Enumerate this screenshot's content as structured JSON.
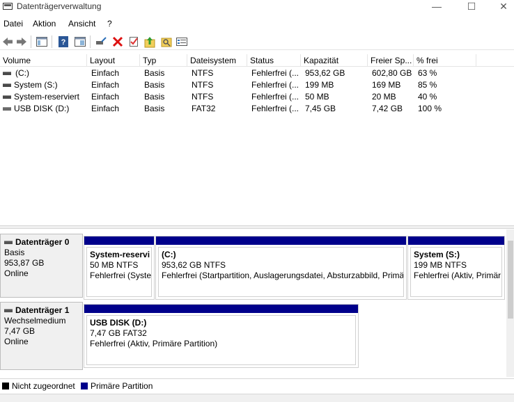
{
  "window": {
    "title": "Datenträgerverwaltung",
    "minimize": "—",
    "maximize": "☐",
    "close": "✕"
  },
  "menu": [
    "Datei",
    "Aktion",
    "Ansicht",
    "?"
  ],
  "toolbar_icons": [
    "back-icon",
    "forward-icon",
    "console-tree-icon",
    "help-icon",
    "properties-icon",
    "connect-icon",
    "delete-icon",
    "check-icon",
    "import-icon",
    "export-icon",
    "list-icon"
  ],
  "volume_list": {
    "columns": [
      "Volume",
      "Layout",
      "Typ",
      "Dateisystem",
      "Status",
      "Kapazität",
      "Freier Sp...",
      "% frei"
    ],
    "rows": [
      {
        "volume": "(C:)",
        "layout": "Einfach",
        "typ": "Basis",
        "fs": "NTFS",
        "status": "Fehlerfrei (...",
        "kap": "953,62 GB",
        "frei": "602,80 GB",
        "pct": "63 %"
      },
      {
        "volume": "System (S:)",
        "layout": "Einfach",
        "typ": "Basis",
        "fs": "NTFS",
        "status": "Fehlerfrei (...",
        "kap": "199 MB",
        "frei": "169 MB",
        "pct": "85 %"
      },
      {
        "volume": "System-reserviert",
        "layout": "Einfach",
        "typ": "Basis",
        "fs": "NTFS",
        "status": "Fehlerfrei (...",
        "kap": "50 MB",
        "frei": "20 MB",
        "pct": "40 %"
      },
      {
        "volume": "USB DISK (D:)",
        "layout": "Einfach",
        "typ": "Basis",
        "fs": "FAT32",
        "status": "Fehlerfrei (...",
        "kap": "7,45 GB",
        "frei": "7,42 GB",
        "pct": "100 %"
      }
    ]
  },
  "disks": [
    {
      "name": "Datenträger 0",
      "type": "Basis",
      "size": "953,87 GB",
      "state": "Online",
      "partitions": [
        {
          "name": "System-reservi",
          "size": "50 MB NTFS",
          "status": "Fehlerfrei (Syster"
        },
        {
          "name": "(C:)",
          "size": "953,62 GB NTFS",
          "status": "Fehlerfrei (Startpartition, Auslagerungsdatei, Absturzabbild, Primä"
        },
        {
          "name": "System  (S:)",
          "size": "199 MB NTFS",
          "status": "Fehlerfrei (Aktiv, Primär"
        }
      ]
    },
    {
      "name": "Datenträger 1",
      "type": "Wechselmedium",
      "size": "7,47 GB",
      "state": "Online",
      "partitions": [
        {
          "name": "USB DISK  (D:)",
          "size": "7,47 GB FAT32",
          "status": "Fehlerfrei (Aktiv, Primäre Partition)"
        }
      ]
    }
  ],
  "legend": [
    {
      "label": "Nicht zugeordnet",
      "color": "#000000"
    },
    {
      "label": "Primäre Partition",
      "color": "#00008b"
    }
  ]
}
